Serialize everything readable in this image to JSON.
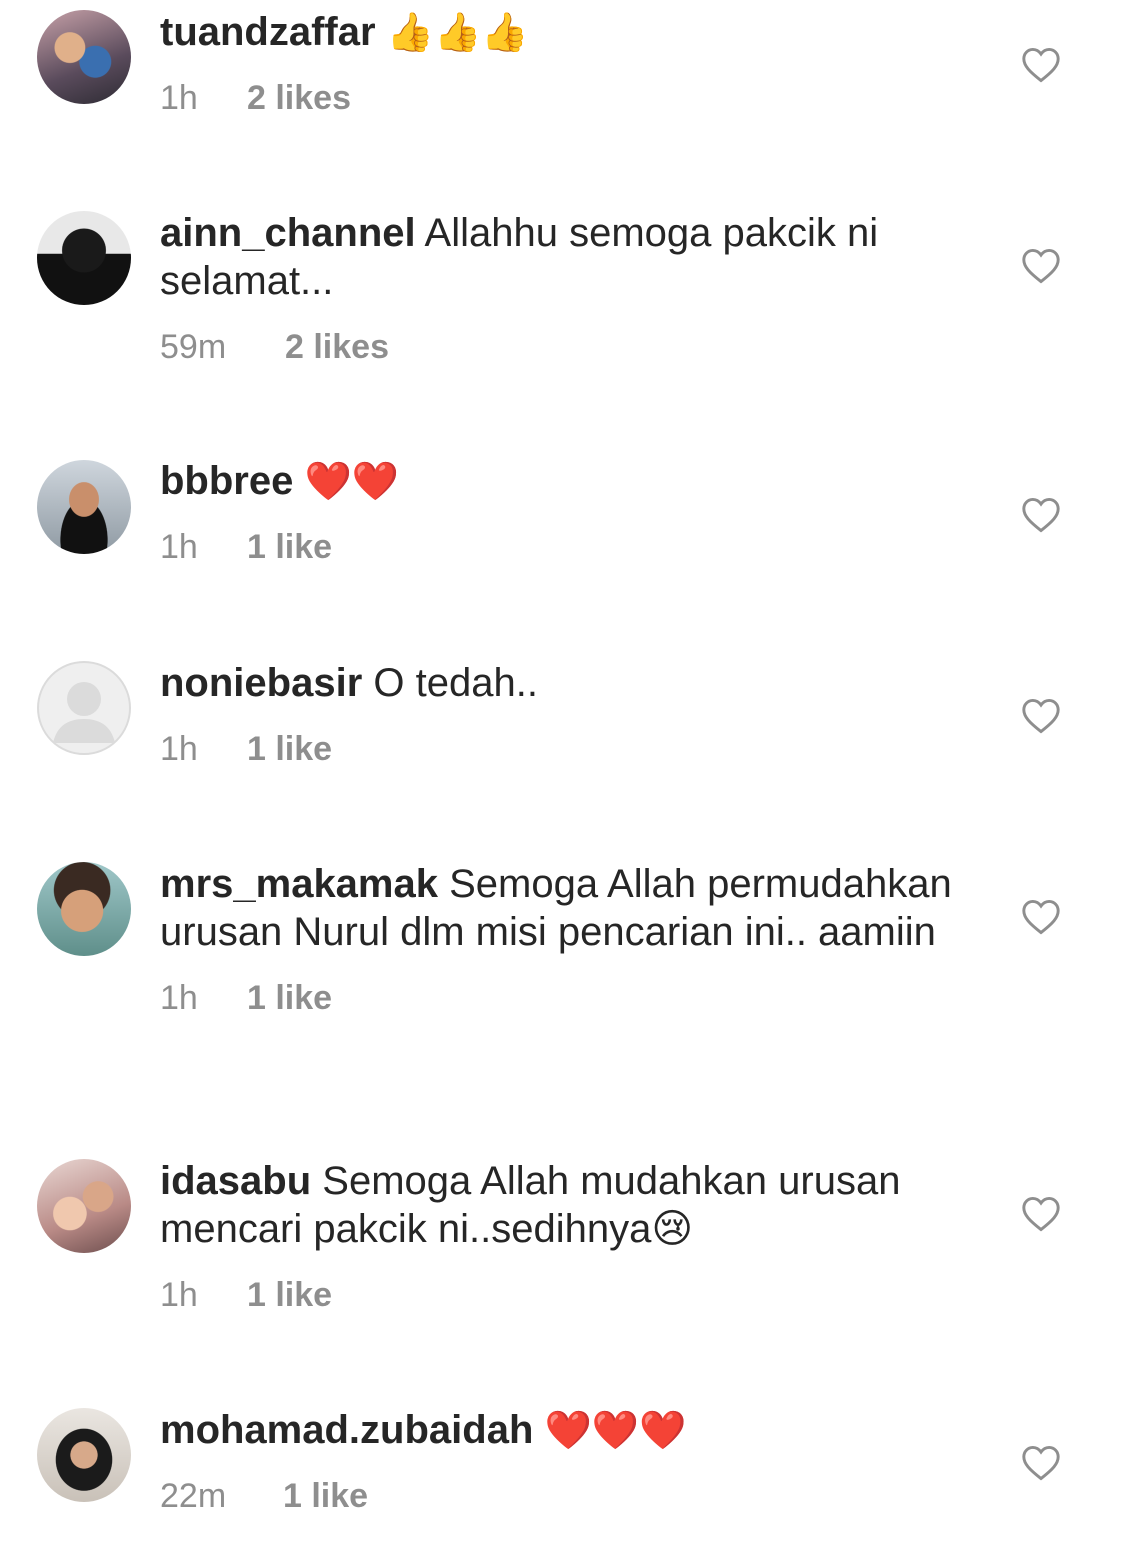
{
  "comments": [
    {
      "username": "tuandzaffar",
      "text": "👍👍👍",
      "emoji_only": true,
      "time": "1h",
      "likes": "2 likes",
      "avatar": "photo"
    },
    {
      "username": "ainn_channel",
      "text": "Allahhu semoga pakcik ni selamat...",
      "emoji_only": false,
      "time": "59m",
      "likes": "2 likes",
      "avatar": "photo"
    },
    {
      "username": "bbbree",
      "text": "❤️❤️",
      "emoji_only": true,
      "time": "1h",
      "likes": "1 like",
      "avatar": "photo"
    },
    {
      "username": "noniebasir",
      "text": "O tedah..",
      "emoji_only": false,
      "time": "1h",
      "likes": "1 like",
      "avatar": "default-avatar"
    },
    {
      "username": "mrs_makamak",
      "text": "Semoga Allah permudahkan urusan Nurul dlm misi pencarian ini.. aamiin",
      "emoji_only": false,
      "time": "1h",
      "likes": "1 like",
      "avatar": "photo"
    },
    {
      "username": "idasabu",
      "text": "Semoga Allah mudahkan urusan mencari pakcik ni..sedihnya😢",
      "emoji_only": false,
      "time": "1h",
      "likes": "1 like",
      "avatar": "photo"
    },
    {
      "username": "mohamad.zubaidah",
      "text": "❤️❤️❤️",
      "emoji_only": true,
      "time": "22m",
      "likes": "1 like",
      "avatar": "photo"
    }
  ],
  "icons": {
    "like": "heart-outline-icon"
  },
  "colors": {
    "text": "#262626",
    "meta": "#8e8e8e",
    "heart_stroke": "#8e8e8e"
  }
}
